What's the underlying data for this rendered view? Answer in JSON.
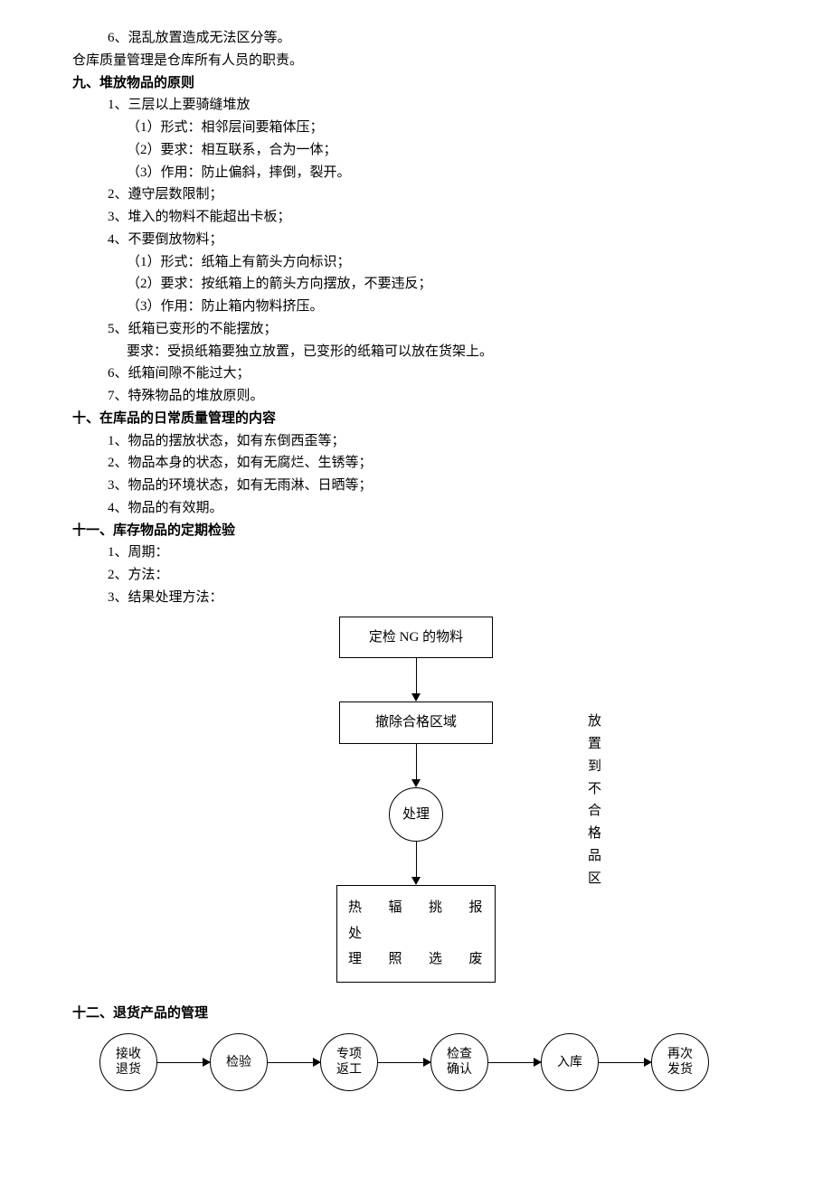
{
  "lines": {
    "l1": "6、混乱放置造成无法区分等。",
    "l2": "仓库质量管理是仓库所有人员的职责。",
    "h9": "九、堆放物品的原则",
    "l3": "1、三层以上要骑缝堆放",
    "l4": "（1）形式：相邻层间要箱体压；",
    "l5": "（2）要求：相互联系，合为一体；",
    "l6": "（3）作用：防止偏斜，摔倒，裂开。",
    "l7": "2、遵守层数限制；",
    "l8": "3、堆入的物料不能超出卡板；",
    "l9": "4、不要倒放物料；",
    "l10": "（1）形式：纸箱上有箭头方向标识；",
    "l11": "（2）要求：按纸箱上的箭头方向摆放，不要违反；",
    "l12": "（3）作用：防止箱内物料挤压。",
    "l13": "5、纸箱已变形的不能摆放；",
    "l14": "要求：受损纸箱要独立放置，已变形的纸箱可以放在货架上。",
    "l15": "6、纸箱间隙不能过大；",
    "l16": "7、特殊物品的堆放原则。",
    "h10": "十、在库品的日常质量管理的内容",
    "l17": "1、物品的摆放状态，如有东倒西歪等；",
    "l18": "2、物品本身的状态，如有无腐烂、生锈等；",
    "l19": "3、物品的环境状态，如有无雨淋、日晒等；",
    "l20": "4、物品的有效期。",
    "h11": "十一、库存物品的定期检验",
    "l21": "1、周期：",
    "l22": "2、方法：",
    "l23": "3、结果处理方法：",
    "h12": "十二、退货产品的管理"
  },
  "chart_data": [
    {
      "type": "flowchart",
      "direction": "vertical",
      "nodes": [
        {
          "id": "n1",
          "shape": "rect",
          "label": "定检 NG 的物料"
        },
        {
          "id": "n2",
          "shape": "rect",
          "label": "撤除合格区域",
          "side_note": "放置到不合格品区"
        },
        {
          "id": "n3",
          "shape": "circle",
          "label": "处理"
        },
        {
          "id": "n4",
          "shape": "rect",
          "grid": [
            [
              "热",
              "辐",
              "挑",
              "报"
            ],
            [
              "处",
              "",
              "",
              ""
            ],
            [
              "理",
              "照",
              "选",
              "废"
            ]
          ]
        }
      ],
      "edges": [
        [
          "n1",
          "n2"
        ],
        [
          "n2",
          "n3"
        ],
        [
          "n3",
          "n4"
        ]
      ]
    },
    {
      "type": "flowchart",
      "direction": "horizontal",
      "nodes": [
        {
          "id": "s1",
          "shape": "circle",
          "label": "接收\n退货"
        },
        {
          "id": "s2",
          "shape": "circle",
          "label": "检验"
        },
        {
          "id": "s3",
          "shape": "circle",
          "label": "专项\n返工"
        },
        {
          "id": "s4",
          "shape": "circle",
          "label": "检查\n确认"
        },
        {
          "id": "s5",
          "shape": "circle",
          "label": "入库"
        },
        {
          "id": "s6",
          "shape": "circle",
          "label": "再次\n发货"
        }
      ],
      "edges": [
        [
          "s1",
          "s2"
        ],
        [
          "s2",
          "s3"
        ],
        [
          "s3",
          "s4"
        ],
        [
          "s4",
          "s5"
        ],
        [
          "s5",
          "s6"
        ]
      ]
    }
  ]
}
